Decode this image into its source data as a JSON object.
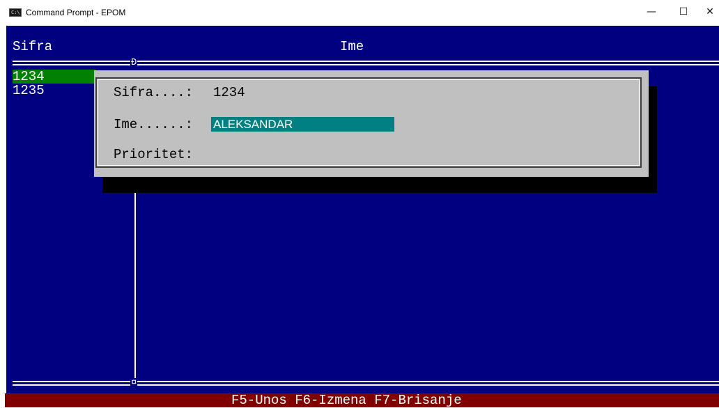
{
  "window": {
    "title": "Command Prompt - EPOM",
    "icon": "cmd-icon",
    "icon_text": "C:\\",
    "minimize_glyph": "—",
    "maximize_glyph": "☐",
    "close_glyph": "✕"
  },
  "table": {
    "columns": [
      "Sifra",
      "Ime"
    ],
    "rows": [
      {
        "sifra": "1234",
        "selected": true
      },
      {
        "sifra": "1235",
        "selected": false
      }
    ],
    "junction_top": "Ð",
    "junction_bottom": "¤"
  },
  "dialog": {
    "sifra_label": "Sifra....:",
    "sifra_value": "1234",
    "ime_label": "Ime......:",
    "ime_value": "ALEKSANDAR",
    "prioritet_label": "Prioritet:",
    "prioritet_value": ""
  },
  "status_bar": {
    "text": "F5-Unos F6-Izmena F7-Brisanje"
  },
  "colors": {
    "console_bg": "#000080",
    "selected_row": "#008000",
    "dialog_bg": "#c0c0c0",
    "input_bg": "#008080",
    "status_bg": "#800000"
  }
}
